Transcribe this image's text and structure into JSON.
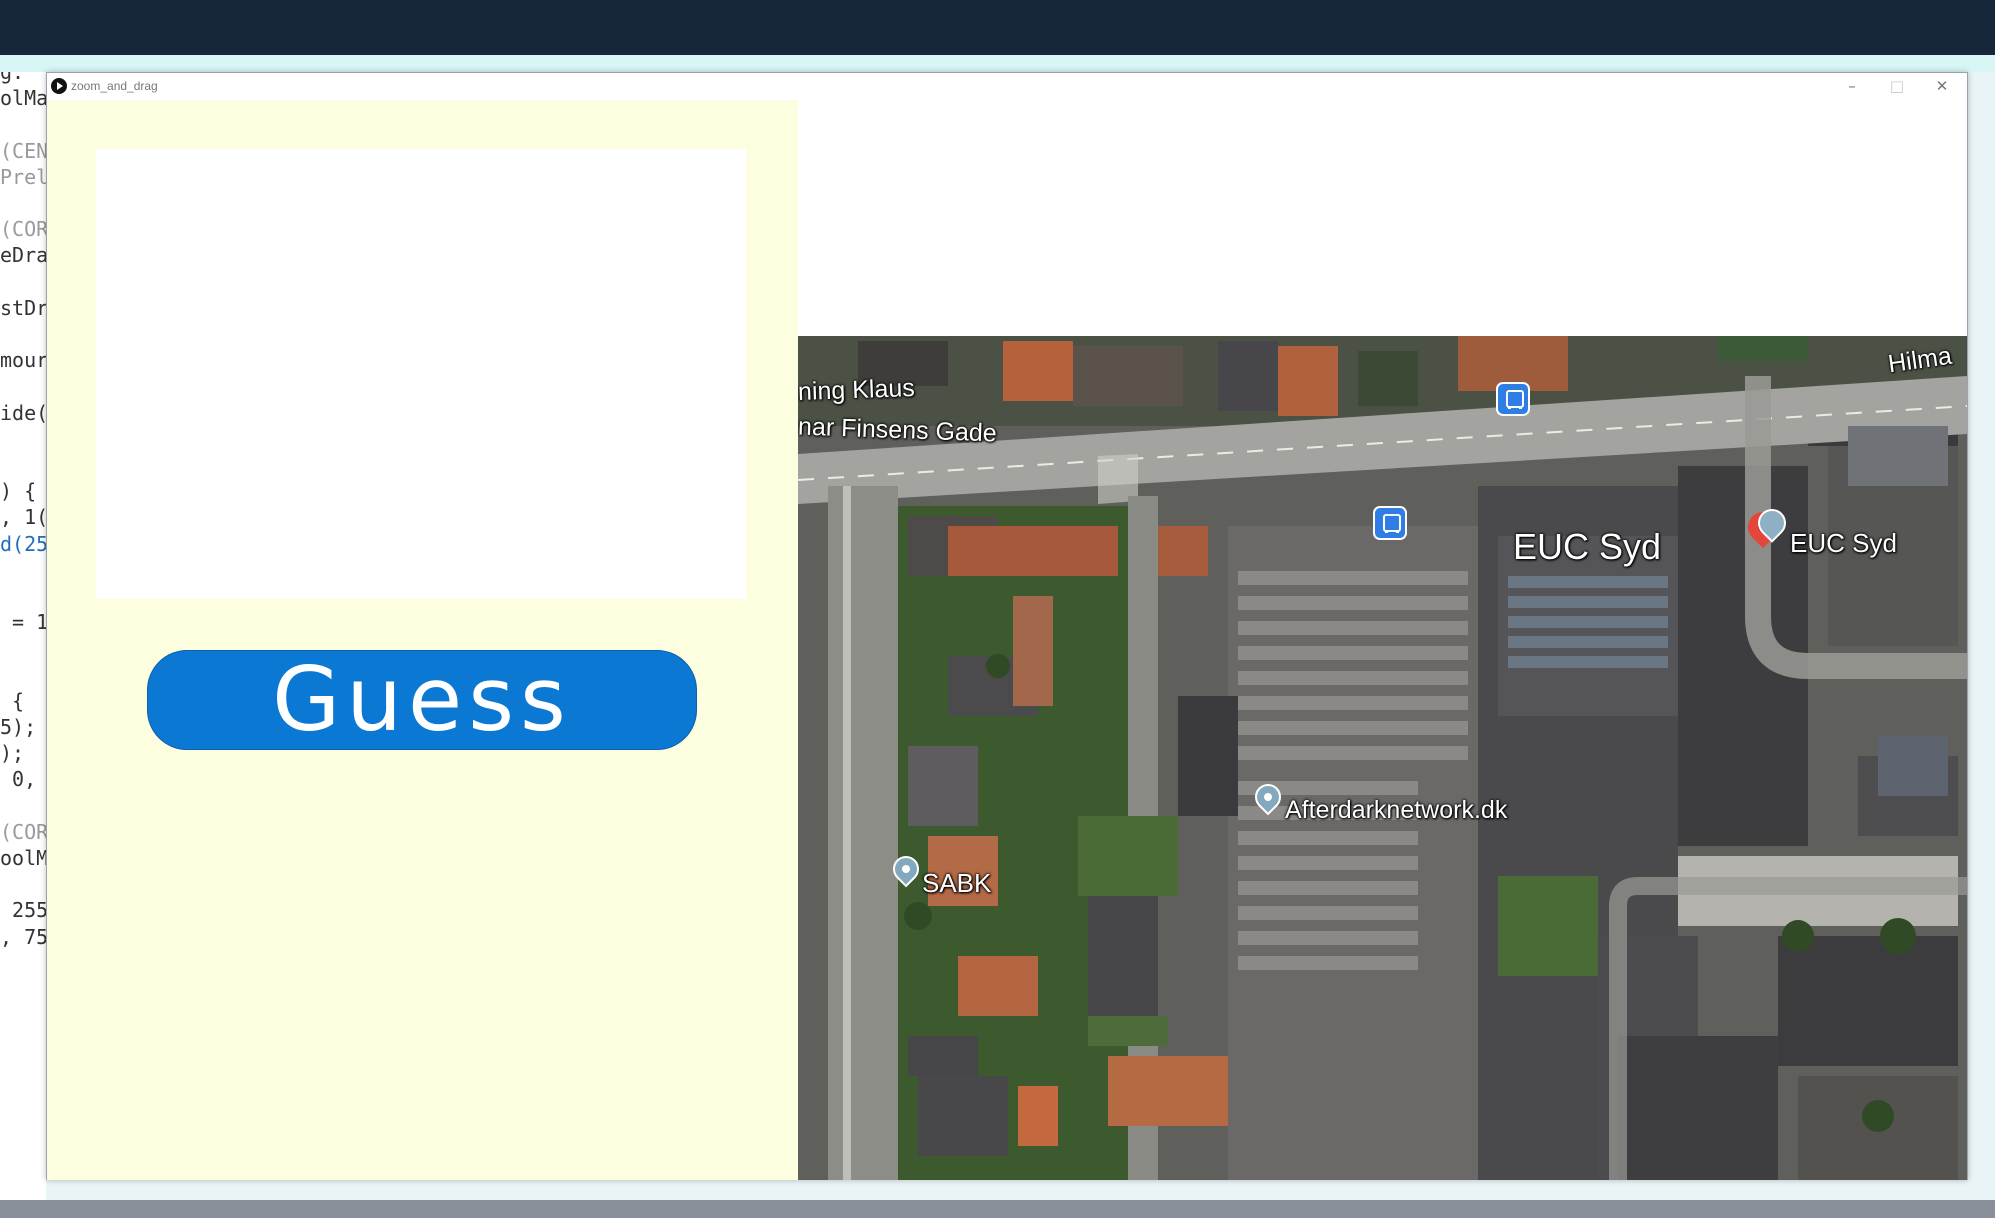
{
  "editor": {
    "lines": [
      "g:",
      "olMa",
      "",
      "(CEN",
      "Prel",
      "",
      "(COR",
      "eDra",
      "",
      "stDr",
      "",
      "mour",
      "",
      "ide(",
      "",
      "",
      ") {",
      ", 1(",
      "d(25",
      "",
      "",
      " = 1",
      "",
      "",
      " {",
      "5);",
      ");",
      " 0,",
      "",
      "(COR",
      "oolM",
      "",
      " 255",
      ", 75"
    ]
  },
  "window": {
    "title": "zoom_and_drag",
    "minimize_glyph": "–",
    "maximize_glyph": "□",
    "close_glyph": "✕"
  },
  "panel": {
    "guess_label": "Guess"
  },
  "map": {
    "labels": {
      "street_north_1": "ning Klaus",
      "street_north_2": "nar Finsens Gade",
      "street_east": "Hilma",
      "euc_main": "EUC Syd",
      "euc_pin": "EUC Syd",
      "afterdark": "Afterdarknetwork.dk",
      "sabk": "SABK"
    }
  },
  "colors": {
    "top_bar": "#15263a",
    "panel_bg": "#fdfedf",
    "button_bg": "#0b78d4",
    "button_text": "#ffffff"
  }
}
